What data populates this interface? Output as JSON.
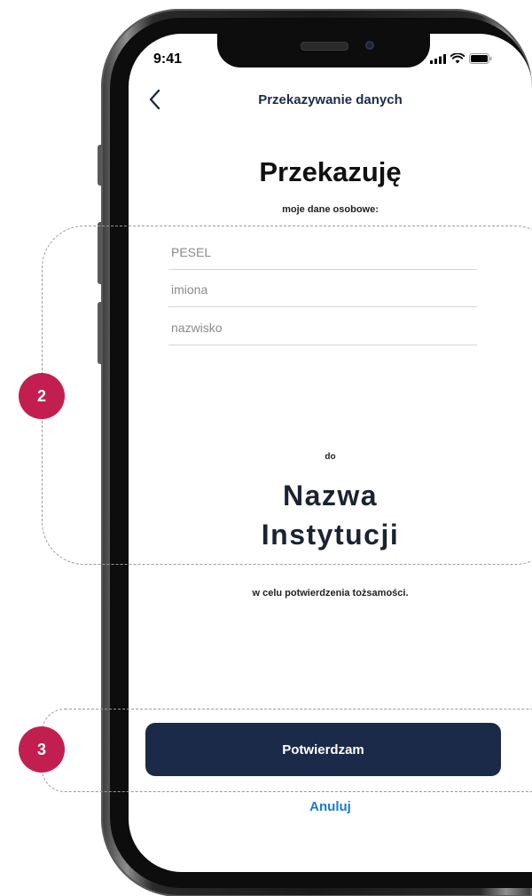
{
  "status_bar": {
    "time": "9:41"
  },
  "header": {
    "title": "Przekazywanie danych"
  },
  "main": {
    "heading": "Przekazuję",
    "subheading": "moje dane osobowe:",
    "fields": {
      "pesel_placeholder": "PESEL",
      "first_names_placeholder": "imiona",
      "last_name_placeholder": "nazwisko"
    },
    "to_label": "do",
    "institution": {
      "line1": "Nazwa",
      "line2": "Instytucji"
    },
    "purpose": "w celu potwierdzenia tożsamości."
  },
  "actions": {
    "confirm_label": "Potwierdzam",
    "cancel_label": "Anuluj"
  },
  "callouts": {
    "region_2": "2",
    "region_3": "3"
  },
  "colors": {
    "primary_button": "#1b2a48",
    "link": "#1a78d6",
    "callout": "#c21f50",
    "title_text": "#1b2b4a"
  },
  "icons": {
    "back": "chevron-left-icon",
    "signal": "cellular-signal-icon",
    "wifi": "wifi-icon",
    "battery": "battery-icon"
  }
}
